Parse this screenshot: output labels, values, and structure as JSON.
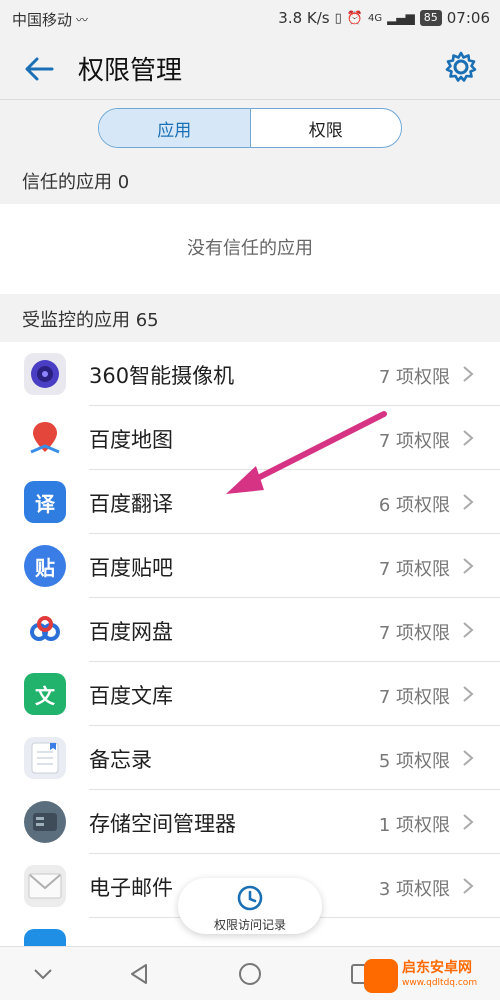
{
  "status_bar": {
    "carrier": "中国移动",
    "speed": "3.8 K/s",
    "network": "4G",
    "battery": "85",
    "time": "07:06"
  },
  "header": {
    "title": "权限管理"
  },
  "tabs": [
    {
      "label": "应用",
      "active": true
    },
    {
      "label": "权限",
      "active": false
    }
  ],
  "trusted": {
    "header": "信任的应用 0",
    "empty_text": "没有信任的应用"
  },
  "monitored": {
    "header": "受监控的应用 65",
    "apps": [
      {
        "name": "360智能摄像机",
        "count": "7 项权限",
        "icon": "camera-360-icon",
        "color": "#5b4bd6"
      },
      {
        "name": "百度地图",
        "count": "7 项权限",
        "icon": "baidu-map-icon",
        "color": "#e5463b"
      },
      {
        "name": "百度翻译",
        "count": "6 项权限",
        "icon": "baidu-translate-icon",
        "color": "#2f7de0",
        "glyph": "译"
      },
      {
        "name": "百度贴吧",
        "count": "7 项权限",
        "icon": "baidu-tieba-icon",
        "color": "#3a7de6",
        "glyph": "贴"
      },
      {
        "name": "百度网盘",
        "count": "7 项权限",
        "icon": "baidu-netdisk-icon",
        "color": "#2b6fd8"
      },
      {
        "name": "百度文库",
        "count": "7 项权限",
        "icon": "baidu-wenku-icon",
        "color": "#21b36b",
        "glyph": "文"
      },
      {
        "name": "备忘录",
        "count": "5 项权限",
        "icon": "memo-icon",
        "color": "#e9edf3"
      },
      {
        "name": "存储空间管理器",
        "count": "1 项权限",
        "icon": "storage-manager-icon",
        "color": "#5b6e7d"
      },
      {
        "name": "电子邮件",
        "count": "3 项权限",
        "icon": "email-icon",
        "color": "#e8e8e8"
      },
      {
        "name": "",
        "count": "",
        "icon": "phone-icon",
        "color": "#1f8fe6"
      }
    ]
  },
  "fab": {
    "label": "权限访问记录"
  },
  "watermark": {
    "name": "启东安卓网",
    "url": "www.qdltdq.com"
  },
  "colors": {
    "accent": "#1a6fb5",
    "arrow": "#d63384"
  }
}
